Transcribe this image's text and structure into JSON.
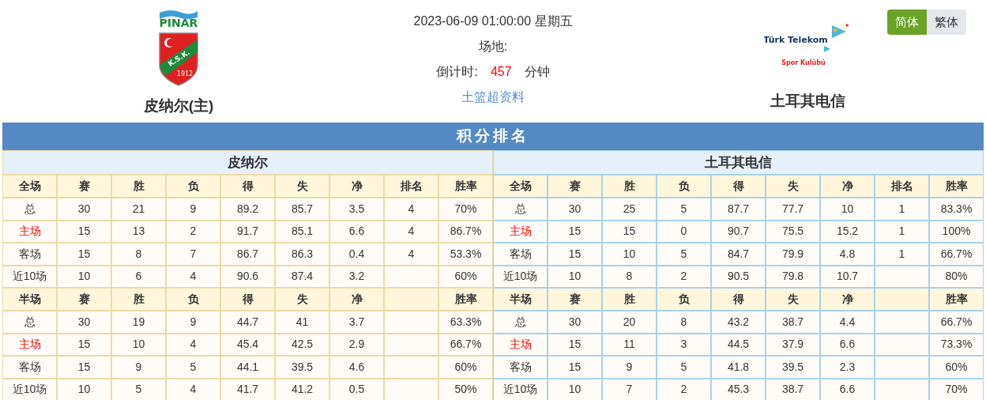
{
  "home_team": {
    "name": "皮纳尔(主)",
    "logo": {
      "brand": "PINAR",
      "initials": "K.S.K.",
      "year": "1912"
    }
  },
  "match": {
    "datetime": "2023-06-09 01:00:00 星期五",
    "venue_label": "场地:",
    "countdown_label": "倒计时:",
    "countdown_value": "457",
    "countdown_unit": "分钟",
    "link": "土篮超资料"
  },
  "away_team": {
    "name": "土耳其电信",
    "logo": {
      "brand": "Türk Telekom",
      "subtitle": "Spor Kulübü"
    }
  },
  "language_toggle": [
    {
      "label": "简体",
      "selected": true
    },
    {
      "label": "繁体",
      "selected": false
    }
  ],
  "standings": {
    "title": "积分排名",
    "teams": [
      {
        "name": "皮纳尔",
        "sections": [
          {
            "header": [
              "全场",
              "赛",
              "胜",
              "负",
              "得",
              "失",
              "净",
              "排名",
              "胜率"
            ],
            "rows": [
              {
                "cells": [
                  "总",
                  "30",
                  "21",
                  "9",
                  "89.2",
                  "85.7",
                  "3.5",
                  "4",
                  "70%"
                ],
                "highlight": false
              },
              {
                "cells": [
                  "主场",
                  "15",
                  "13",
                  "2",
                  "91.7",
                  "85.1",
                  "6.6",
                  "4",
                  "86.7%"
                ],
                "highlight": true
              },
              {
                "cells": [
                  "客场",
                  "15",
                  "8",
                  "7",
                  "86.7",
                  "86.3",
                  "0.4",
                  "4",
                  "53.3%"
                ],
                "highlight": false
              },
              {
                "cells": [
                  "近10场",
                  "10",
                  "6",
                  "4",
                  "90.6",
                  "87.4",
                  "3.2",
                  "",
                  "60%"
                ],
                "highlight": false
              }
            ]
          },
          {
            "header": [
              "半场",
              "赛",
              "胜",
              "负",
              "得",
              "失",
              "净",
              {
                "kind": "blank"
              },
              "胜率"
            ],
            "rows": [
              {
                "cells": [
                  "总",
                  "30",
                  "19",
                  "9",
                  "44.7",
                  "41",
                  "3.7",
                  "",
                  "63.3%"
                ],
                "highlight": false
              },
              {
                "cells": [
                  "主场",
                  "15",
                  "10",
                  "4",
                  "45.4",
                  "42.5",
                  "2.9",
                  "",
                  "66.7%"
                ],
                "highlight": true
              },
              {
                "cells": [
                  "客场",
                  "15",
                  "9",
                  "5",
                  "44.1",
                  "39.5",
                  "4.6",
                  "",
                  "60%"
                ],
                "highlight": false
              },
              {
                "cells": [
                  "近10场",
                  "10",
                  "5",
                  "4",
                  "41.7",
                  "41.2",
                  "0.5",
                  "",
                  "50%"
                ],
                "highlight": false
              }
            ]
          }
        ]
      },
      {
        "name": "土耳其电信",
        "sections": [
          {
            "header": [
              "全场",
              "赛",
              "胜",
              "负",
              "得",
              "失",
              "净",
              "排名",
              "胜率"
            ],
            "rows": [
              {
                "cells": [
                  "总",
                  "30",
                  "25",
                  "5",
                  "87.7",
                  "77.7",
                  "10",
                  "1",
                  "83.3%"
                ],
                "highlight": false
              },
              {
                "cells": [
                  "主场",
                  "15",
                  "15",
                  "0",
                  "90.7",
                  "75.5",
                  "15.2",
                  "1",
                  "100%"
                ],
                "highlight": true
              },
              {
                "cells": [
                  "客场",
                  "15",
                  "10",
                  "5",
                  "84.7",
                  "79.9",
                  "4.8",
                  "1",
                  "66.7%"
                ],
                "highlight": false
              },
              {
                "cells": [
                  "近10场",
                  "10",
                  "8",
                  "2",
                  "90.5",
                  "79.8",
                  "10.7",
                  "",
                  "80%"
                ],
                "highlight": false
              }
            ]
          },
          {
            "header": [
              "半场",
              "赛",
              "胜",
              "负",
              "得",
              "失",
              "净",
              {
                "kind": "blank"
              },
              "胜率"
            ],
            "rows": [
              {
                "cells": [
                  "总",
                  "30",
                  "20",
                  "8",
                  "43.2",
                  "38.7",
                  "4.4",
                  "",
                  "66.7%"
                ],
                "highlight": false
              },
              {
                "cells": [
                  "主场",
                  "15",
                  "11",
                  "3",
                  "44.5",
                  "37.9",
                  "6.6",
                  "",
                  "73.3%"
                ],
                "highlight": true
              },
              {
                "cells": [
                  "客场",
                  "15",
                  "9",
                  "5",
                  "41.8",
                  "39.5",
                  "2.3",
                  "",
                  "60%"
                ],
                "highlight": false
              },
              {
                "cells": [
                  "近10场",
                  "10",
                  "7",
                  "2",
                  "45.3",
                  "38.7",
                  "6.6",
                  "",
                  "70%"
                ],
                "highlight": false
              }
            ]
          }
        ]
      }
    ]
  }
}
